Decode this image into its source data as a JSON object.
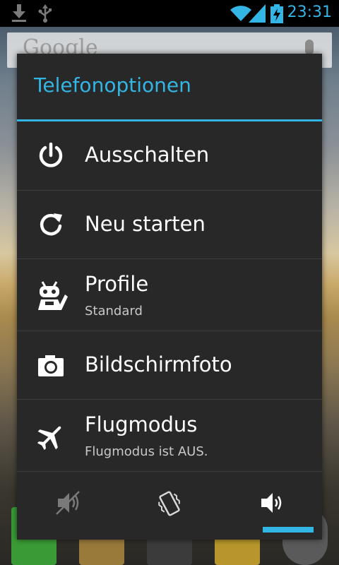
{
  "status_bar": {
    "time": "23:31",
    "accent_color": "#33b5e5",
    "left_icons": [
      "download-icon",
      "usb-icon"
    ],
    "right_icons": [
      "wifi-icon",
      "signal-icon",
      "battery-charging-icon"
    ]
  },
  "home_screen": {
    "search_bar_text": "Google"
  },
  "dialog": {
    "title": "Telefonoptionen",
    "items": [
      {
        "icon": "power-icon",
        "label": "Ausschalten",
        "sublabel": ""
      },
      {
        "icon": "restart-icon",
        "label": "Neu starten",
        "sublabel": ""
      },
      {
        "icon": "profile-robot-icon",
        "label": "Profile",
        "sublabel": "Standard"
      },
      {
        "icon": "camera-icon",
        "label": "Bildschirmfoto",
        "sublabel": ""
      },
      {
        "icon": "airplane-icon",
        "label": "Flugmodus",
        "sublabel": "Flugmodus ist AUS."
      }
    ],
    "sound_modes": [
      {
        "icon": "silent-icon",
        "active": false
      },
      {
        "icon": "vibrate-icon",
        "active": false
      },
      {
        "icon": "sound-on-icon",
        "active": true
      }
    ]
  }
}
